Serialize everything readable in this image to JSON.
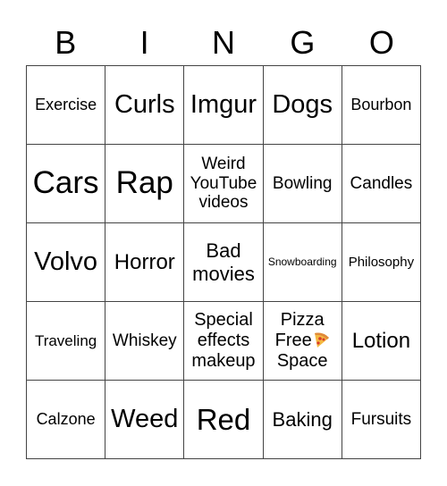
{
  "header": [
    "B",
    "I",
    "N",
    "G",
    "O"
  ],
  "cells": [
    [
      "Exercise",
      "Curls",
      "Imgur",
      "Dogs",
      "Bourbon"
    ],
    [
      "Cars",
      "Rap",
      "Weird YouTube videos",
      "Bowling",
      "Candles"
    ],
    [
      "Volvo",
      "Horror",
      "Bad movies",
      "Snowboarding",
      "Philosophy"
    ],
    [
      "Traveling",
      "Whiskey",
      "Special effects makeup",
      "Pizza Free Space",
      "Lotion"
    ],
    [
      "Calzone",
      "Weed",
      "Red",
      "Baking",
      "Fursuits"
    ]
  ],
  "free_space": {
    "line1": "Pizza",
    "line2": "Free",
    "line3": "Space",
    "icon": "pizza-icon"
  }
}
